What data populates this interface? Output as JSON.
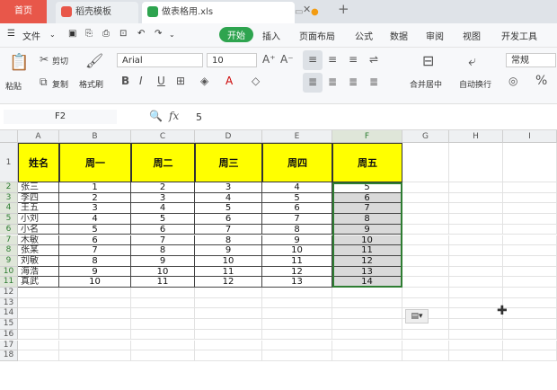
{
  "titlebar": {
    "tab_home": "首页",
    "tab_daoke": "稻壳模板",
    "tab_file": "做表格用.xls"
  },
  "menubar": {
    "file": "文件",
    "items": [
      "开始",
      "插入",
      "页面布局",
      "公式",
      "数据",
      "审阅",
      "视图",
      "开发工具"
    ]
  },
  "ribbon": {
    "paste": "粘贴",
    "cut": "剪切",
    "copy": "复制",
    "format_painter": "格式刷",
    "font_name": "Arial",
    "font_size": "10",
    "merge_center": "合并居中",
    "wrap_text": "自动换行",
    "number_format": "常规",
    "bold": "B",
    "italic": "I",
    "underline": "U",
    "percent": "%"
  },
  "formula_bar": {
    "name_box": "F2",
    "fx": "fx",
    "value": "5"
  },
  "grid": {
    "columns": [
      "A",
      "B",
      "C",
      "D",
      "E",
      "F",
      "G",
      "H",
      "I"
    ],
    "rows": [
      "1",
      "2",
      "3",
      "4",
      "5",
      "6",
      "7",
      "8",
      "9",
      "10",
      "11",
      "12",
      "13",
      "14",
      "15",
      "16",
      "17",
      "18"
    ],
    "header_row": [
      "姓名",
      "周一",
      "周二",
      "周三",
      "周四",
      "周五"
    ],
    "names": [
      "张三",
      "李四",
      "王五",
      "小刘",
      "小名",
      "木敏",
      "张某",
      "刘敏",
      "海浩",
      "真武"
    ],
    "values": [
      [
        1,
        2,
        3,
        4,
        5
      ],
      [
        2,
        3,
        4,
        5,
        6
      ],
      [
        3,
        4,
        5,
        6,
        7
      ],
      [
        4,
        5,
        6,
        7,
        8
      ],
      [
        5,
        6,
        7,
        8,
        9
      ],
      [
        6,
        7,
        8,
        9,
        10
      ],
      [
        7,
        8,
        9,
        10,
        11
      ],
      [
        8,
        9,
        10,
        11,
        12
      ],
      [
        9,
        10,
        11,
        12,
        13
      ],
      [
        10,
        11,
        12,
        13,
        14
      ]
    ]
  },
  "colors": {
    "header_fill": "#ffff00",
    "selection_fill": "#d9d9d9",
    "accent_green": "#2ea44f",
    "home_tab": "#e8574a"
  }
}
